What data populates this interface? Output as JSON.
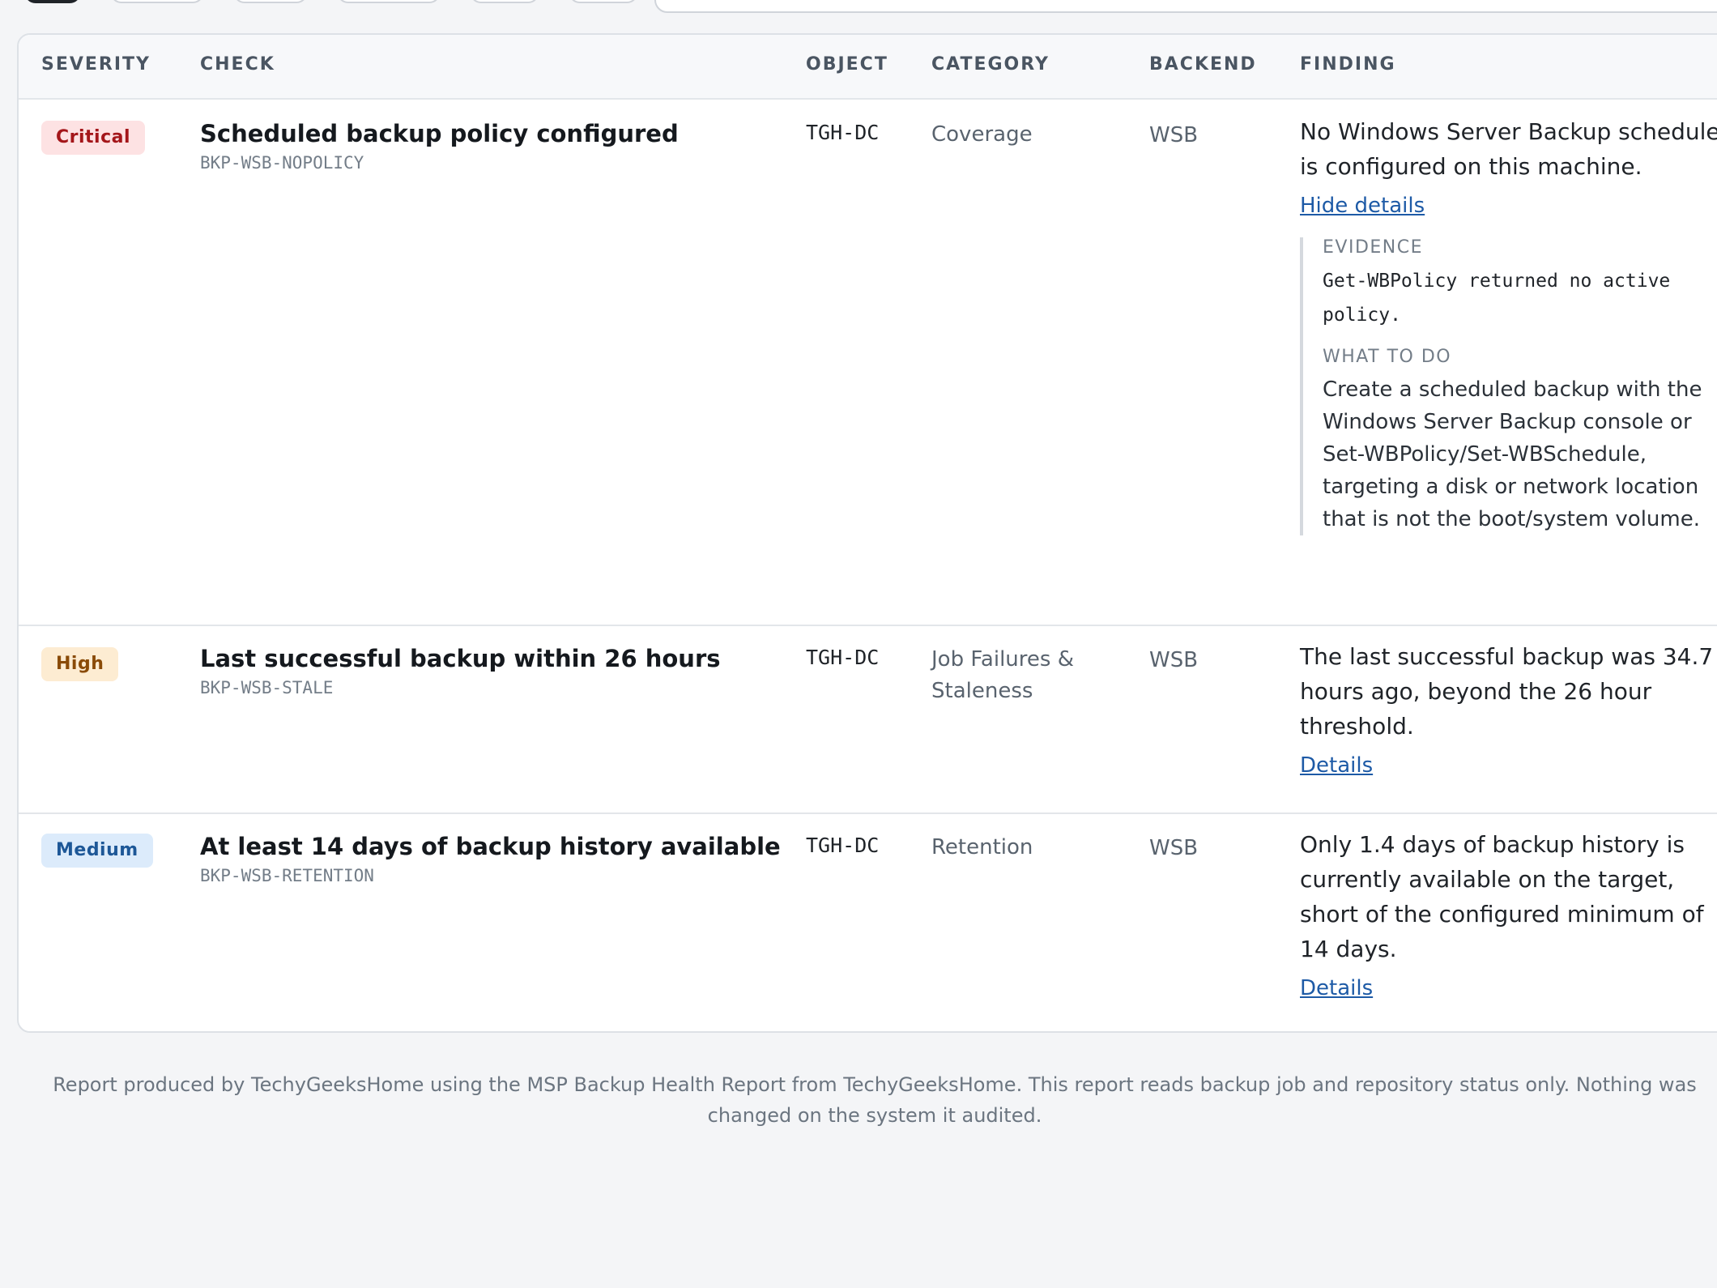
{
  "table": {
    "headers": {
      "severity": "SEVERITY",
      "check": "CHECK",
      "object": "OBJECT",
      "category": "CATEGORY",
      "backend": "BACKEND",
      "finding": "FINDING"
    },
    "rows": [
      {
        "severity": "Critical",
        "check_title": "Scheduled backup policy configured",
        "check_id": "BKP-WSB-NOPOLICY",
        "object": "TGH-DC",
        "category": "Coverage",
        "backend": "WSB",
        "finding": "No Windows Server Backup schedule is configured on this machine.",
        "toggle_label": "Hide details",
        "evidence_label": "EVIDENCE",
        "evidence": "Get-WBPolicy returned no active policy.",
        "todo_label": "WHAT TO DO",
        "todo": "Create a scheduled backup with the Windows Server Backup console or Set-WBPolicy/Set-WBSchedule, targeting a disk or network location that is not the boot/system volume."
      },
      {
        "severity": "High",
        "check_title": "Last successful backup within 26 hours",
        "check_id": "BKP-WSB-STALE",
        "object": "TGH-DC",
        "category": "Job Failures & Staleness",
        "backend": "WSB",
        "finding": "The last successful backup was 34.7 hours ago, beyond the 26 hour threshold.",
        "toggle_label": "Details"
      },
      {
        "severity": "Medium",
        "check_title": "At least 14 days of backup history available",
        "check_id": "BKP-WSB-RETENTION",
        "object": "TGH-DC",
        "category": "Retention",
        "backend": "WSB",
        "finding": "Only 1.4 days of backup history is currently available on the target, short of the configured minimum of 14 days.",
        "toggle_label": "Details"
      }
    ]
  },
  "footer": {
    "text": "Report produced by TechyGeeksHome using the MSP Backup Health Report from TechyGeeksHome. This report reads backup job and repository status only. Nothing was changed on the system it audited."
  },
  "colors": {
    "critical_bg": "#fde2e3",
    "critical_fg": "#a4161a",
    "high_bg": "#fdecd2",
    "high_fg": "#8a4b08",
    "medium_bg": "#dcebfb",
    "medium_fg": "#1d5797",
    "link": "#1d5aa6"
  }
}
